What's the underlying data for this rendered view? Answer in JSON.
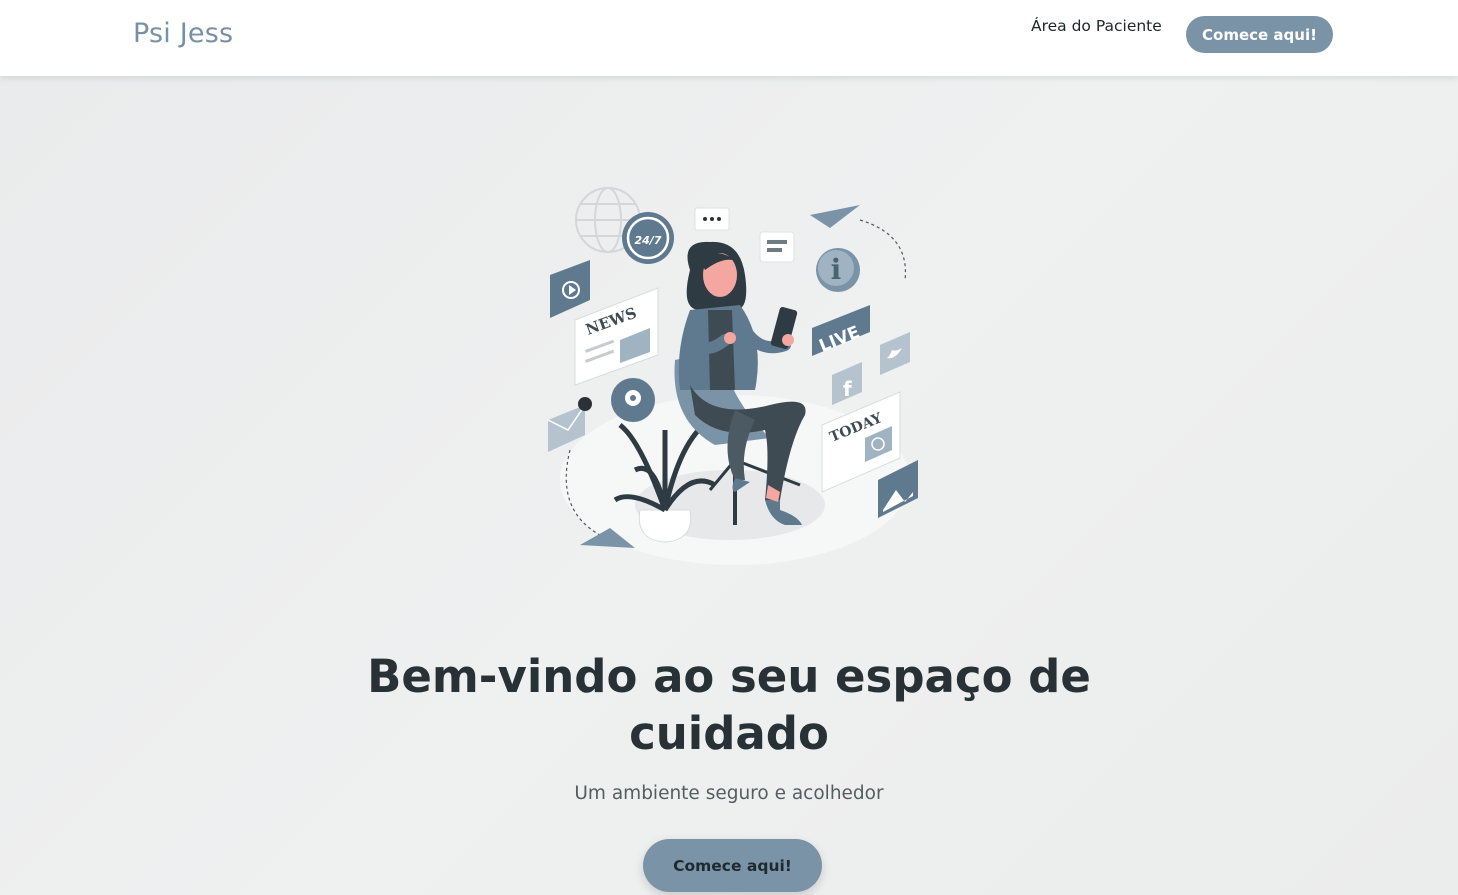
{
  "navbar": {
    "brand": "Psi Jess",
    "patient_area_link": "Área do Paciente",
    "cta_label": "Comece aqui!"
  },
  "hero": {
    "illustration": {
      "news_label": "NEWS",
      "clock_label": "24/7",
      "live_label": "LIVE",
      "today_label": "TODAY",
      "info_label": "i",
      "facebook_label": "f"
    },
    "title": "Bem-vindo ao seu espaço de cuidado",
    "subtitle": "Um ambiente seguro e acolhedor",
    "cta_label": "Comece aqui!"
  },
  "colors": {
    "accent": "#7a93a7",
    "brand_text": "#7890a4",
    "background": "#ecedee",
    "heading": "#283236"
  }
}
